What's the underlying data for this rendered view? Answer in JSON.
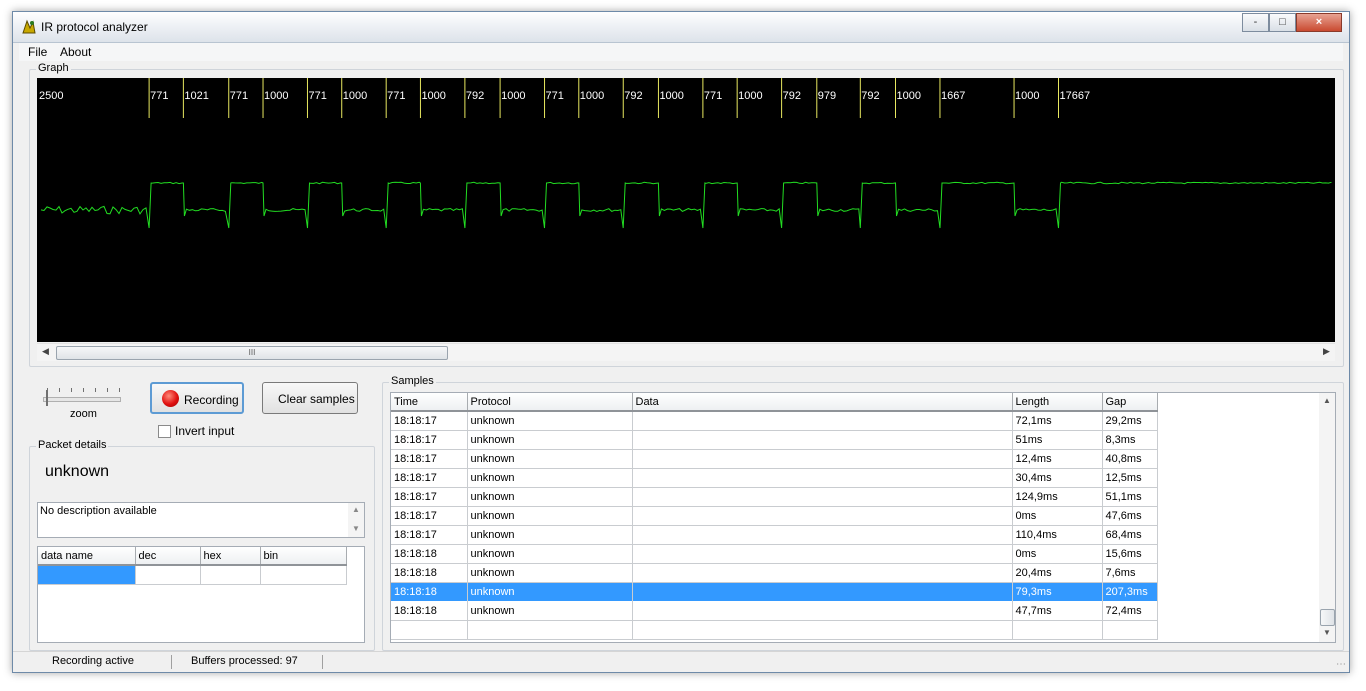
{
  "window": {
    "title": "IR protocol analyzer",
    "controls": [
      "-",
      "□",
      "×"
    ]
  },
  "menu": [
    "File",
    "About"
  ],
  "graph": {
    "label": "Graph",
    "timings": [
      "2500",
      "771",
      "1021",
      "771",
      "1000",
      "771",
      "1000",
      "771",
      "1000",
      "792",
      "1000",
      "771",
      "1000",
      "792",
      "1000",
      "771",
      "1000",
      "792",
      "979",
      "792",
      "1000",
      "1667",
      "1000",
      "17667"
    ],
    "scrollbar_grip": "III"
  },
  "controls": {
    "zoom_label": "zoom",
    "zoom_level": 0,
    "recording_button": "Recording",
    "clear_button": "Clear samples",
    "invert_input_label": "Invert input",
    "invert_input_checked": false
  },
  "packet_details": {
    "label": "Packet details",
    "protocol_name": "unknown",
    "description": "No description available",
    "columns": [
      "data name",
      "dec",
      "hex",
      "bin"
    ]
  },
  "samples": {
    "label": "Samples",
    "columns": [
      "Time",
      "Protocol",
      "Data",
      "Length",
      "Gap"
    ],
    "rows": [
      {
        "time": "18:18:17",
        "protocol": "unknown",
        "data": "",
        "length": "72,1ms",
        "gap": "29,2ms"
      },
      {
        "time": "18:18:17",
        "protocol": "unknown",
        "data": "",
        "length": "51ms",
        "gap": "8,3ms"
      },
      {
        "time": "18:18:17",
        "protocol": "unknown",
        "data": "",
        "length": "12,4ms",
        "gap": "40,8ms"
      },
      {
        "time": "18:18:17",
        "protocol": "unknown",
        "data": "",
        "length": "30,4ms",
        "gap": "12,5ms"
      },
      {
        "time": "18:18:17",
        "protocol": "unknown",
        "data": "",
        "length": "124,9ms",
        "gap": "51,1ms"
      },
      {
        "time": "18:18:17",
        "protocol": "unknown",
        "data": "",
        "length": "0ms",
        "gap": "47,6ms"
      },
      {
        "time": "18:18:17",
        "protocol": "unknown",
        "data": "",
        "length": "110,4ms",
        "gap": "68,4ms"
      },
      {
        "time": "18:18:18",
        "protocol": "unknown",
        "data": "",
        "length": "0ms",
        "gap": "15,6ms"
      },
      {
        "time": "18:18:18",
        "protocol": "unknown",
        "data": "",
        "length": "20,4ms",
        "gap": "7,6ms"
      },
      {
        "time": "18:18:18",
        "protocol": "unknown",
        "data": "",
        "length": "79,3ms",
        "gap": "207,3ms",
        "selected": true
      },
      {
        "time": "18:18:18",
        "protocol": "unknown",
        "data": "",
        "length": "47,7ms",
        "gap": "72,4ms"
      }
    ]
  },
  "status": {
    "state": "Recording active",
    "buffers": "Buffers processed: 97"
  },
  "colors": {
    "signal": "#22dd22",
    "marker": "#e8e860",
    "graph_bg": "#000000",
    "selection": "#3399ff"
  }
}
